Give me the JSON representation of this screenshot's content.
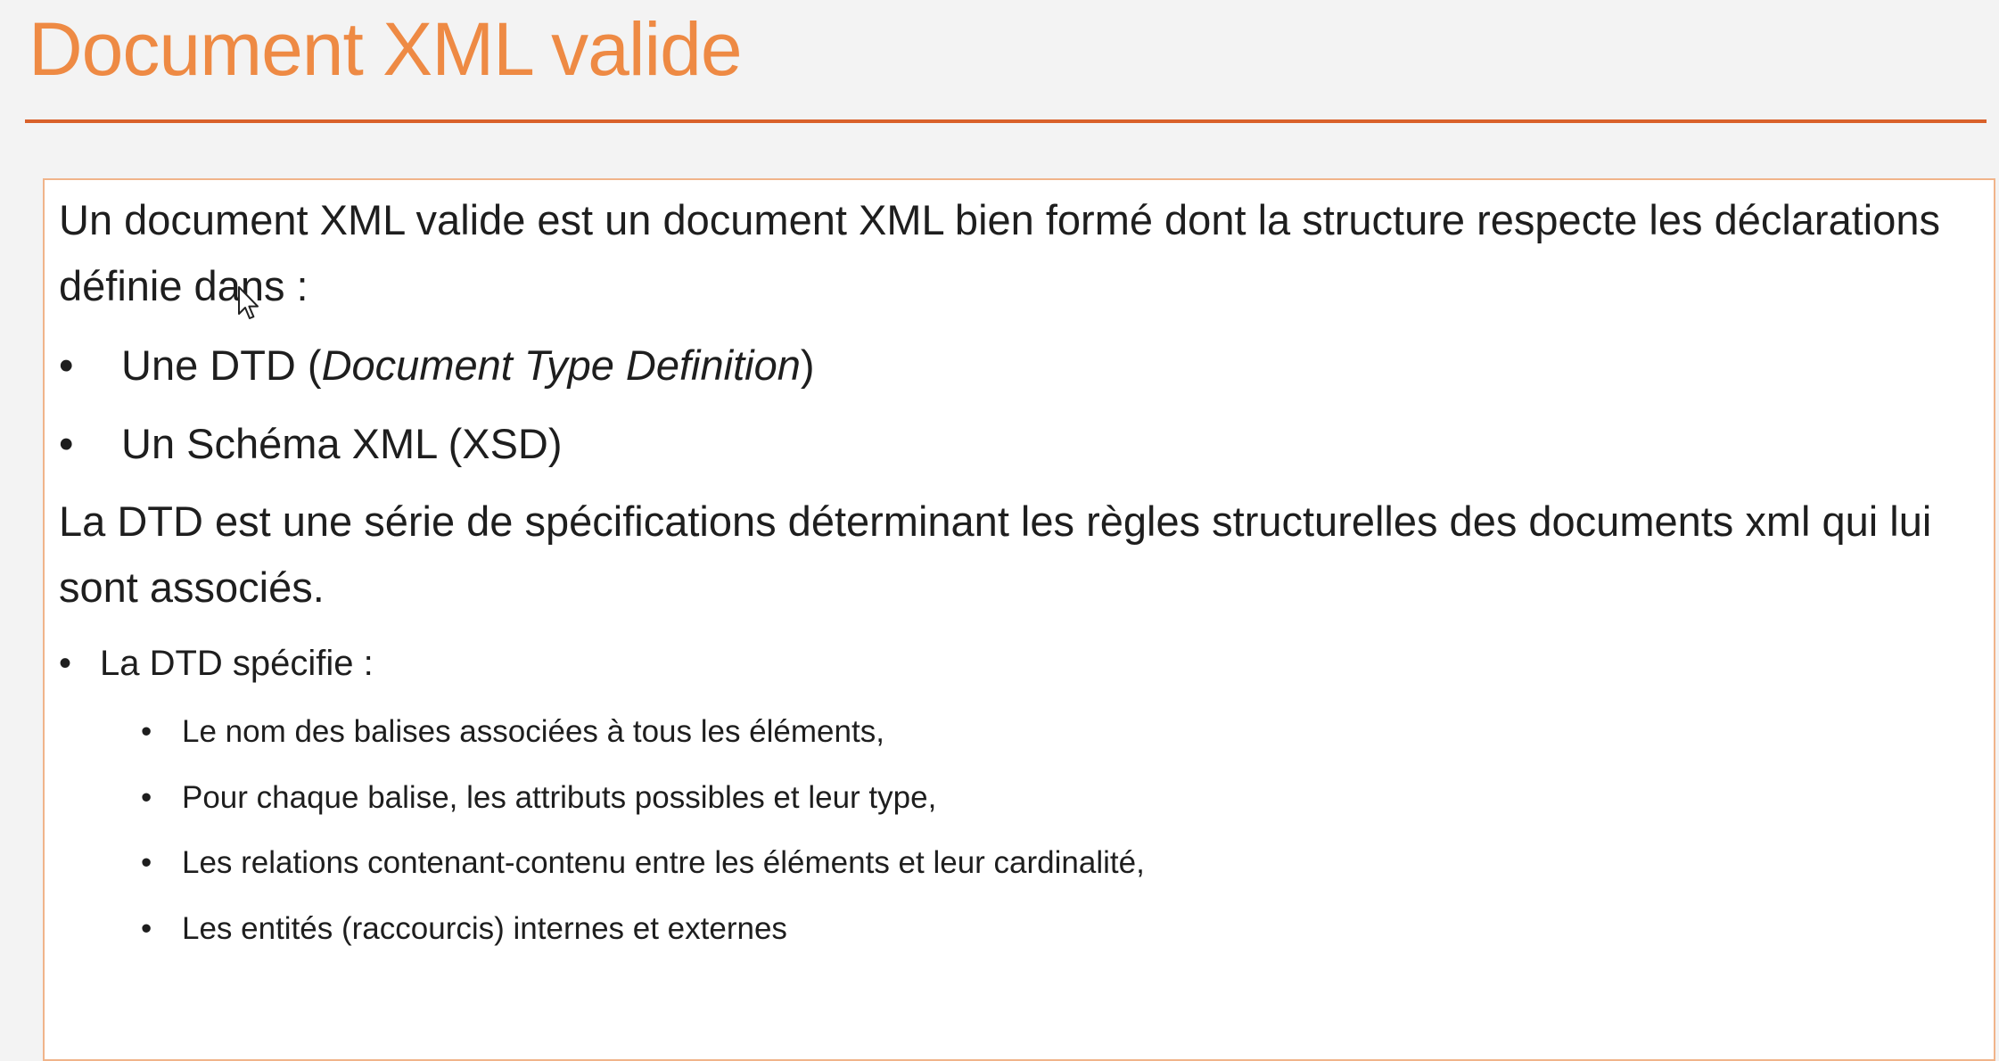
{
  "slide": {
    "title": "Document XML valide",
    "intro": "Un document XML valide est un document XML bien formé dont la structure respecte les déclarations définie dans :",
    "top_bullets": [
      {
        "bullet": "•",
        "prefix": "Une DTD (",
        "emphasis": "Document Type Definition",
        "suffix": ")"
      },
      {
        "bullet": "•",
        "text": "Un Schéma XML (XSD)"
      }
    ],
    "dtd_description": "La DTD est une série de spécifications déterminant les règles structurelles  des documents xml qui lui sont associés.",
    "dtd_bullet": {
      "bullet": "•",
      "label": "La DTD spécifie :"
    },
    "dtd_sub_bullets": [
      {
        "bullet": "•",
        "text": "Le nom des balises associées à tous les éléments,"
      },
      {
        "bullet": "•",
        "text": "Pour chaque balise, les attributs possibles et leur type,"
      },
      {
        "bullet": "•",
        "text": "Les relations contenant-contenu entre les éléments et leur cardinalité,"
      },
      {
        "bullet": "•",
        "text": "Les  entités (raccourcis) internes et externes"
      }
    ]
  },
  "colors": {
    "title": "#ee8a44",
    "rule": "#d9612a",
    "box_border": "#f0b48a",
    "background": "#f3f3f3",
    "text": "#1e1e1e"
  },
  "icons": {
    "cursor": "mouse-pointer-icon"
  }
}
